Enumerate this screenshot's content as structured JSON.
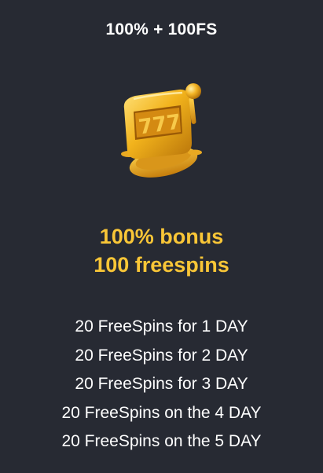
{
  "offer": {
    "title": "100% + 100FS",
    "icon": "slot-machine-icon",
    "bonus_line1": "100% bonus",
    "bonus_line2": "100 freespins",
    "schedule": [
      "20 FreeSpins for 1 DAY",
      "20 FreeSpins for 2 DAY",
      "20 FreeSpins for 3 DAY",
      "20 FreeSpins on the 4 DAY",
      "20 FreeSpins on the 5 DAY"
    ]
  },
  "colors": {
    "background": "#272a33",
    "accent": "#f9c637",
    "text": "#ffffff"
  }
}
